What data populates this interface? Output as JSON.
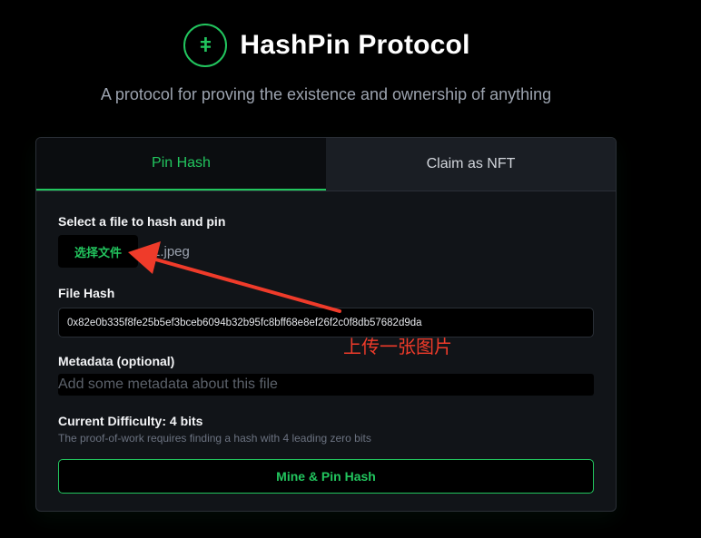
{
  "header": {
    "logo_glyph": "ǂ",
    "title": "HashPin Protocol",
    "subtitle": "A protocol for proving the existence and ownership of anything"
  },
  "tabs": [
    {
      "label": "Pin Hash",
      "active": true
    },
    {
      "label": "Claim as NFT",
      "active": false
    }
  ],
  "form": {
    "file_label": "Select a file to hash and pin",
    "choose_file_label": "选择文件",
    "file_name": "1.jpeg",
    "hash_label": "File Hash",
    "hash_value": "0x82e0b335f8fe25b5ef3bceb6094b32b95fc8bff68e8ef26f2c0f8db57682d9da",
    "metadata_label": "Metadata (optional)",
    "metadata_placeholder": "Add some metadata about this file",
    "difficulty_label": "Current Difficulty: 4 bits",
    "difficulty_hint": "The proof-of-work requires finding a hash with 4 leading zero bits",
    "submit_label": "Mine & Pin Hash"
  },
  "annotation": {
    "text": "上传一张图片",
    "color": "#ef3b2a"
  },
  "colors": {
    "accent": "#22c55e",
    "background": "#000000",
    "card": "#111418"
  }
}
